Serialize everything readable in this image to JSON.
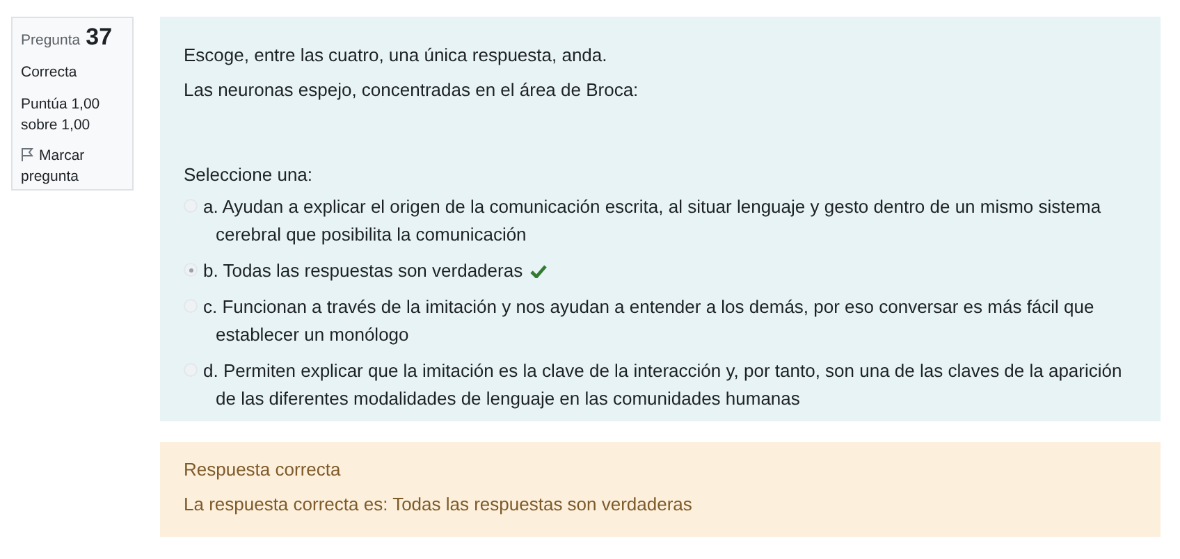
{
  "info": {
    "label": "Pregunta",
    "number": "37",
    "state": "Correcta",
    "grade": "Puntúa 1,00 sobre 1,00",
    "flag": "Marcar pregunta",
    "flagged": false
  },
  "question": {
    "instruction": "Escoge, entre las cuatro, una única respuesta, anda.",
    "text": "Las neuronas espejo, concentradas en el área de Broca:",
    "prompt": "Seleccione una:",
    "options": [
      {
        "text": "a. Ayudan a explicar el origen de la comunicación escrita, al situar lenguaje y gesto dentro de un mismo sistema cerebral que posibilita la comunicación",
        "selected": false,
        "correct": false
      },
      {
        "text": "b. Todas las respuestas son verdaderas",
        "selected": true,
        "correct": true
      },
      {
        "text": "c. Funcionan a través de la imitación y nos ayudan a entender a los demás, por eso conversar es más fácil que establecer un monólogo",
        "selected": false,
        "correct": false
      },
      {
        "text": "d. Permiten explicar que la imitación es la clave de la interacción y, por tanto, son una de las claves de la aparición de las diferentes modalidades de lenguaje en las comunidades humanas",
        "selected": false,
        "correct": false
      }
    ]
  },
  "feedback": {
    "status": "Respuesta correcta",
    "answer": "La respuesta correcta es: Todas las respuestas son verdaderas"
  }
}
